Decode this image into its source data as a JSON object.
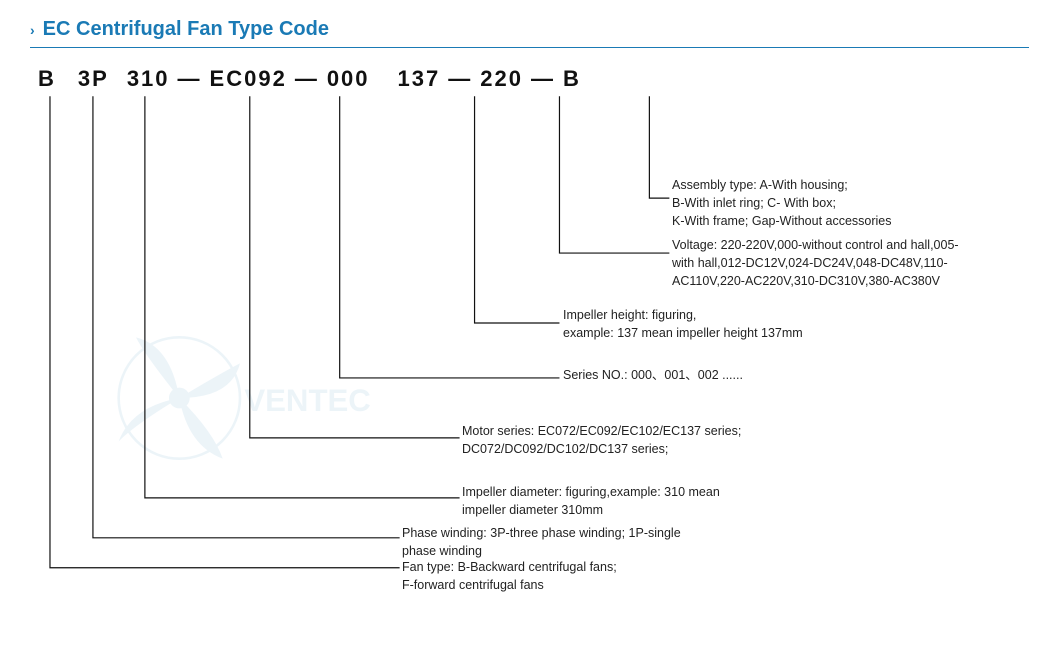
{
  "title": {
    "chevron": "›",
    "text": "EC Centrifugal Fan Type Code"
  },
  "code": {
    "parts": [
      "B",
      "3P",
      "310",
      "EC092",
      "000",
      "137",
      "220",
      "B"
    ],
    "dashes": [
      "—",
      "—",
      "—",
      "—",
      "—",
      "—"
    ]
  },
  "annotations": {
    "assembly": {
      "label": "Assembly type:",
      "line1": "Assembly type:  A-With housing;",
      "line2": "B-With inlet ring;  C- With box;",
      "line3": "K-With frame; Gap-Without accessories"
    },
    "voltage": {
      "line1": "Voltage:  220-220V,000-without control and hall,005-",
      "line2": "with hall,012-DC12V,024-DC24V,048-DC48V,110-",
      "line3": "AC110V,220-AC220V,310-DC310V,380-AC380V"
    },
    "impeller_height": {
      "line1": "Impeller height:   figuring,",
      "line2": "example: 137 mean impeller height 137mm"
    },
    "series": {
      "line1": "Series NO.:  000、001、002 ......"
    },
    "motor": {
      "line1": "Motor series:  EC072/EC092/EC102/EC137 series;",
      "line2": "DC072/DC092/DC102/DC137 series;"
    },
    "impeller_dia": {
      "line1": "Impeller diameter:  figuring,example: 310 mean",
      "line2": "impeller diameter 310mm"
    },
    "phase": {
      "line1": "Phase winding:  3P-three phase winding;  1P-single",
      "line2": "phase winding"
    },
    "fan_type": {
      "line1": "Fan type:  B-Backward centrifugal fans;",
      "line2": "F-forward centrifugal fans"
    }
  }
}
